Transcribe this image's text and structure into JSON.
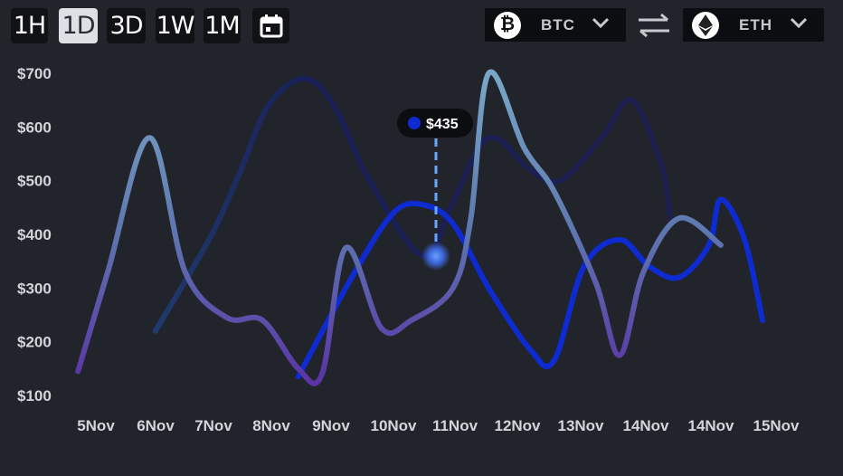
{
  "timeframes": [
    {
      "label": "1H",
      "active": false
    },
    {
      "label": "1D",
      "active": true
    },
    {
      "label": "3D",
      "active": false
    },
    {
      "label": "1W",
      "active": false
    },
    {
      "label": "1M",
      "active": false
    }
  ],
  "icons": {
    "calendar": "calendar-icon",
    "swap": "swap-arrows-icon",
    "chevron": "chevron-down-icon",
    "btc": "bitcoin-icon",
    "eth": "ethereum-icon"
  },
  "pair": {
    "base": "BTC",
    "quote": "ETH"
  },
  "colors": {
    "background": "#22242c",
    "bright_blue": "#0d2bd0",
    "navy": "#1a1d5a",
    "steel": "#6a9ab8",
    "purple": "#5a36a8",
    "tooltip_bg": "#0c0d10"
  },
  "tooltip": {
    "value": "$435",
    "dot_color": "#0d2bd0"
  },
  "chart_data": {
    "type": "line",
    "x": [
      "5Nov",
      "6Nov",
      "7Nov",
      "8Nov",
      "9Nov",
      "10Nov",
      "11Nov",
      "12Nov",
      "13Nov",
      "14Nov",
      "14Nov",
      "15Nov"
    ],
    "y_ticks": [
      "$100",
      "$200",
      "$300",
      "$400",
      "$500",
      "$600",
      "$700"
    ],
    "ylim": [
      100,
      700
    ],
    "grid": false,
    "series": [
      {
        "style": "navy-fade",
        "points": [
          [
            6.0,
            220
          ],
          [
            6.9,
            390
          ],
          [
            7.4,
            510
          ],
          [
            7.9,
            640
          ],
          [
            8.5,
            690
          ],
          [
            9.0,
            640
          ],
          [
            9.6,
            500
          ],
          [
            10.5,
            360
          ],
          [
            11.0,
            460
          ],
          [
            11.6,
            580
          ],
          [
            12.3,
            520
          ],
          [
            12.8,
            500
          ],
          [
            13.5,
            580
          ],
          [
            14.0,
            650
          ],
          [
            14.5,
            530
          ],
          [
            14.65,
            430
          ]
        ]
      },
      {
        "style": "bright-blue",
        "points": [
          [
            8.4,
            135
          ],
          [
            9.3,
            320
          ],
          [
            10.0,
            440
          ],
          [
            10.5,
            455
          ],
          [
            11.0,
            420
          ],
          [
            11.6,
            300
          ],
          [
            12.3,
            185
          ],
          [
            12.7,
            165
          ],
          [
            13.2,
            340
          ],
          [
            13.8,
            390
          ],
          [
            14.3,
            340
          ],
          [
            14.8,
            320
          ],
          [
            15.3,
            380
          ],
          [
            15.5,
            465
          ],
          [
            15.9,
            390
          ],
          [
            16.2,
            240
          ]
        ]
      },
      {
        "style": "steel-purple",
        "points": [
          [
            4.7,
            145
          ],
          [
            5.2,
            330
          ],
          [
            5.9,
            580
          ],
          [
            6.5,
            330
          ],
          [
            7.2,
            245
          ],
          [
            7.8,
            240
          ],
          [
            8.4,
            150
          ],
          [
            8.8,
            140
          ],
          [
            9.2,
            375
          ],
          [
            9.8,
            225
          ],
          [
            10.3,
            240
          ],
          [
            11.0,
            300
          ],
          [
            11.3,
            430
          ],
          [
            11.6,
            700
          ],
          [
            12.2,
            560
          ],
          [
            12.7,
            480
          ],
          [
            13.4,
            310
          ],
          [
            13.8,
            175
          ],
          [
            14.2,
            330
          ],
          [
            14.8,
            430
          ],
          [
            15.5,
            380
          ]
        ]
      }
    ]
  }
}
